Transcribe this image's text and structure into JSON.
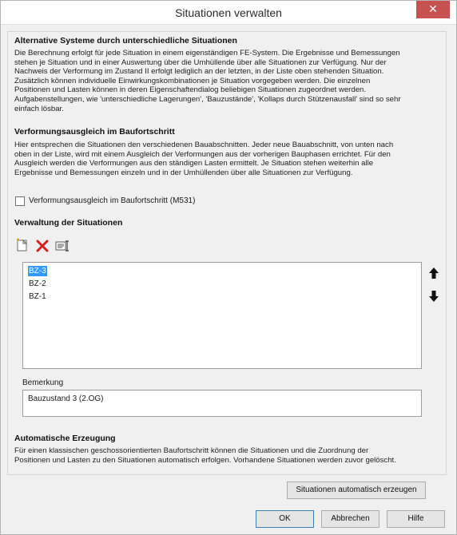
{
  "window": {
    "title": "Situationen verwalten",
    "close_glyph": "✕"
  },
  "sections": {
    "alt_systems": {
      "heading": "Alternative Systeme durch unterschiedliche Situationen",
      "lines": [
        "Die Berechnung erfolgt für jede Situation in einem eigenständigen FE-System. Die Ergebnisse und Bemessungen",
        "stehen je Situation und in einer Auswertung über die Umhüllende über alle Situationen zur Verfügung. Nur der",
        "Nachweis der Verformung im Zustand II erfolgt lediglich an der letzten, in der Liste oben stehenden Situation.",
        "Zusätzlich können individuelle Einwirkungskombinationen je Situation vorgegeben werden. Die einzelnen",
        "Positionen und Lasten können in deren Eigenschaftendialog beliebigen Situationen zugeordnet werden.",
        "Aufgabenstellungen, wie 'unterschiedliche Lagerungen', 'Bauzustände', 'Kollaps durch Stützenausfall' sind so sehr",
        "einfach lösbar."
      ]
    },
    "deformation": {
      "heading": "Verformungsausgleich im Baufortschritt",
      "lines": [
        "Hier entsprechen die Situationen den verschiedenen Bauabschnitten. Jeder neue Bauabschnitt, von unten nach",
        "oben in der Liste, wird mit einem Ausgleich der Verformungen aus der vorherigen Bauphasen errichtet. Für den",
        "Ausgleich werden die Verformungen aus den ständigen Lasten ermittelt. Je Situation stehen weiterhin alle",
        "Ergebnisse und Bemessungen einzeln und in der Umhüllenden über alle Situationen zur Verfügung."
      ],
      "checkbox_label": "Verformungsausgleich im Baufortschritt (M531)",
      "checkbox_checked": false
    },
    "management": {
      "heading": "Verwaltung der Situationen",
      "situations": [
        "BZ-3",
        "BZ-2",
        "BZ-1"
      ],
      "selected_index": 0,
      "remark_label": "Bemerkung",
      "remark_value": "Bauzustand 3 (2.OG)"
    },
    "auto": {
      "heading": "Automatische Erzeugung",
      "lines": [
        "Für einen klassischen geschossorientierten Baufortschritt können die Situationen und die Zuordnung der",
        "Positionen und Lasten zu den Situationen automatisch erfolgen. Vorhandene Situationen werden zuvor gelöscht."
      ]
    }
  },
  "buttons": {
    "auto_create": "Situationen automatisch erzeugen",
    "ok": "OK",
    "cancel": "Abbrechen",
    "help": "Hilfe"
  },
  "icons": {
    "new": "new-document-icon",
    "delete": "delete-x-icon",
    "rename": "rename-icon",
    "up": "arrow-up-icon",
    "down": "arrow-down-icon"
  },
  "colors": {
    "close": "#c75050",
    "selection": "#3399ff",
    "delete": "#d42020"
  }
}
